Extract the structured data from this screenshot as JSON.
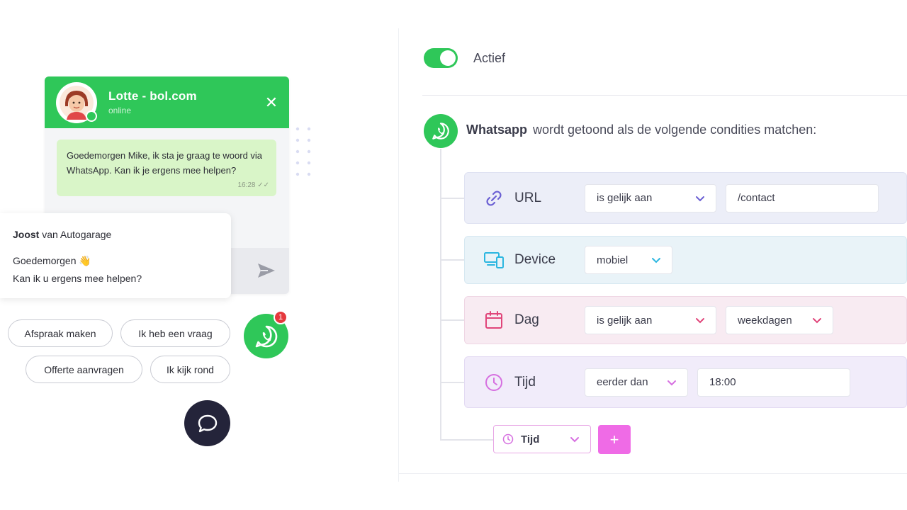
{
  "chat": {
    "agent_name": "Lotte - bol.com",
    "agent_status": "online",
    "close_symbol": "✕",
    "message": "Goedemorgen Mike, ik sta je graag te woord via WhatsApp. Kan ik je ergens mee helpen?",
    "message_time": "16:28 ✓✓"
  },
  "greeting": {
    "sender_name": "Joost",
    "sender_company": " van Autogarage",
    "line1": "Goedemorgen 👋",
    "line2": "Kan ik u ergens mee helpen?"
  },
  "quick_replies": [
    "Afspraak maken",
    "Ik heb een vraag",
    "Offerte aanvragen",
    "Ik kijk rond"
  ],
  "fab": {
    "badge_count": "1"
  },
  "settings": {
    "toggle_label": "Actief",
    "toggle_on": true,
    "channel": "Whatsapp",
    "condition_text": "wordt getoond als de volgende condities matchen:",
    "conditions": [
      {
        "label": "URL",
        "icon": "link-icon",
        "operator": "is gelijk aan",
        "value": "/contact"
      },
      {
        "label": "Device",
        "icon": "devices-icon",
        "operator": "mobiel"
      },
      {
        "label": "Dag",
        "icon": "calendar-icon",
        "operator": "is gelijk aan",
        "value": "weekdagen"
      },
      {
        "label": "Tijd",
        "icon": "clock-icon",
        "operator": "eerder dan",
        "value": "18:00"
      }
    ],
    "new_condition": {
      "label": "Tijd",
      "add_symbol": "+"
    }
  },
  "colors": {
    "whatsapp_green": "#2fc759",
    "bubble_green": "#d9f5c8",
    "dark_fab": "#24243a",
    "badge_red": "#e5393d",
    "url_accent": "#6a5fd3",
    "device_accent": "#2bb6e0",
    "dag_accent": "#e0457a",
    "tijd_accent": "#d66fe0",
    "add_button": "#ef6be6"
  }
}
